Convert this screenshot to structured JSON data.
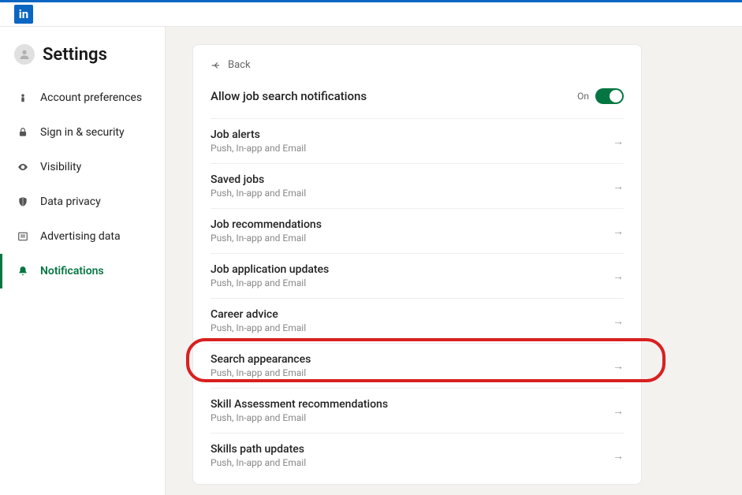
{
  "brand": {
    "logo_text": "in"
  },
  "sidebar": {
    "title": "Settings",
    "items": [
      {
        "label": "Account preferences"
      },
      {
        "label": "Sign in & security"
      },
      {
        "label": "Visibility"
      },
      {
        "label": "Data privacy"
      },
      {
        "label": "Advertising data"
      },
      {
        "label": "Notifications"
      }
    ]
  },
  "panel": {
    "back_label": "Back",
    "toggle": {
      "title": "Allow job search notifications",
      "state_label": "On"
    },
    "rows": [
      {
        "title": "Job alerts",
        "sub": "Push, In-app and Email"
      },
      {
        "title": "Saved jobs",
        "sub": "Push, In-app and Email"
      },
      {
        "title": "Job recommendations",
        "sub": "Push, In-app and Email"
      },
      {
        "title": "Job application updates",
        "sub": "Push, In-app and Email"
      },
      {
        "title": "Career advice",
        "sub": "Push, In-app and Email"
      },
      {
        "title": "Search appearances",
        "sub": "Push, In-app and Email"
      },
      {
        "title": "Skill Assessment recommendations",
        "sub": "Push, In-app and Email"
      },
      {
        "title": "Skills path updates",
        "sub": "Push, In-app and Email"
      }
    ]
  },
  "annotation": {
    "highlighted_row_index": 5
  }
}
